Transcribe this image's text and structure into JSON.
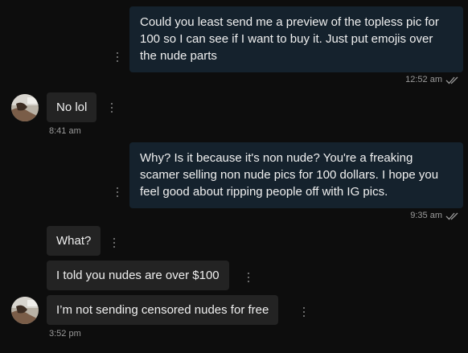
{
  "messages": [
    {
      "direction": "outgoing",
      "text": "Could you least send me a preview of the topless pic for 100 so I can see if I want to buy it. Just put emojis over the nude parts",
      "time": "12:52 am",
      "status_icon": "double-check-icon"
    },
    {
      "direction": "incoming",
      "text": "No lol",
      "time": "8:41 am"
    },
    {
      "direction": "outgoing",
      "text": "Why? Is it because it's non nude? You're a freaking scamer selling non nude pics for 100 dollars. I hope you feel good about ripping people off with IG pics.",
      "time": "9:35 am",
      "status_icon": "double-check-icon"
    },
    {
      "direction": "incoming",
      "text": "What?"
    },
    {
      "direction": "incoming",
      "text": "I told you nudes are over $100"
    },
    {
      "direction": "incoming",
      "text": "I’m not sending censored nudes for free",
      "time": "3:52 pm"
    }
  ],
  "icons": {
    "more": "kebab-menu-icon",
    "read_receipt": "double-check-icon",
    "avatar": "contact-avatar"
  },
  "colors": {
    "background": "#0d0d0d",
    "outgoing_bubble": "#15222d",
    "incoming_bubble": "#232323",
    "timestamp": "#9a9a9a"
  }
}
